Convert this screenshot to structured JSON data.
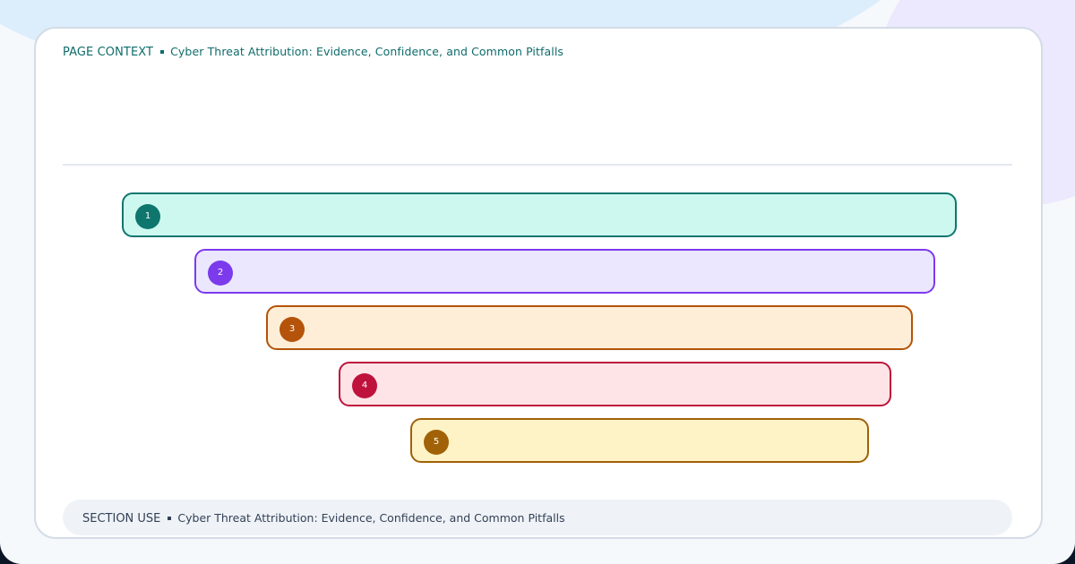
{
  "context": {
    "label": "PAGE CONTEXT",
    "text": "Cyber Threat Attribution: Evidence, Confidence, and Common Pitfalls"
  },
  "diagram": {
    "type": "funnel",
    "steps": [
      {
        "number": "1",
        "label": "",
        "color": "#0f766e",
        "fill": "#cdf8ef"
      },
      {
        "number": "2",
        "label": "",
        "color": "#7c3aed",
        "fill": "#ebe7fe"
      },
      {
        "number": "3",
        "label": "",
        "color": "#b45309",
        "fill": "#ffeed7"
      },
      {
        "number": "4",
        "label": "",
        "color": "#be123c",
        "fill": "#ffe4e7"
      },
      {
        "number": "5",
        "label": "",
        "color": "#a16207",
        "fill": "#fef3c7"
      }
    ]
  },
  "footer": {
    "label": "SECTION USE",
    "text": "Cyber Threat Attribution: Evidence, Confidence, and Common Pitfalls"
  }
}
